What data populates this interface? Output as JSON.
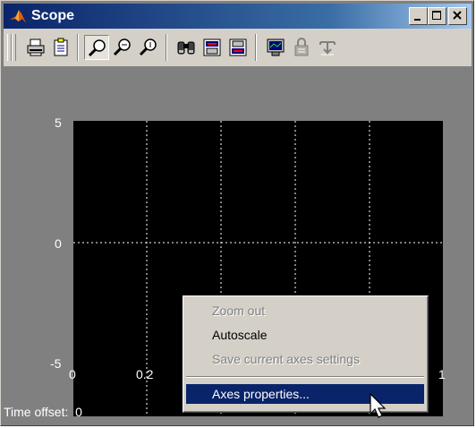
{
  "window": {
    "title": "Scope",
    "app_icon": "matlab-logo-icon",
    "controls": [
      "minimize-icon",
      "maximize-icon",
      "close-icon"
    ]
  },
  "toolbar": {
    "buttons": [
      {
        "icon": "print-icon",
        "state": "normal"
      },
      {
        "icon": "parameters-icon",
        "state": "normal"
      },
      {
        "icon": "zoom-icon",
        "state": "pressed"
      },
      {
        "icon": "zoom-x-icon",
        "state": "normal"
      },
      {
        "icon": "zoom-y-icon",
        "state": "normal"
      },
      {
        "icon": "autoscale-binoculars-icon",
        "state": "normal"
      },
      {
        "icon": "save-axes-settings-icon",
        "state": "normal"
      },
      {
        "icon": "restore-axes-settings-icon",
        "state": "normal"
      },
      {
        "icon": "floating-scope-icon",
        "state": "normal"
      },
      {
        "icon": "lock-axes-icon",
        "state": "disabled"
      },
      {
        "icon": "signal-selection-icon",
        "state": "disabled"
      }
    ]
  },
  "plot": {
    "y_ticks": [
      "5",
      "0",
      "-5"
    ],
    "x_ticks": [
      "0",
      "0.2",
      "1"
    ],
    "time_offset_label": "Time offset:",
    "time_offset_value": "0",
    "colors": {
      "background": "#808080",
      "axes_bg": "#000000",
      "grid": "#ffffff"
    }
  },
  "context_menu": {
    "items": [
      {
        "label": "Zoom out",
        "enabled": false
      },
      {
        "label": "Autoscale",
        "enabled": true
      },
      {
        "label": "Save current axes settings",
        "enabled": false
      },
      {
        "label": "Axes properties...",
        "enabled": true,
        "selected": true
      }
    ],
    "selection_color": "#0a246a"
  }
}
